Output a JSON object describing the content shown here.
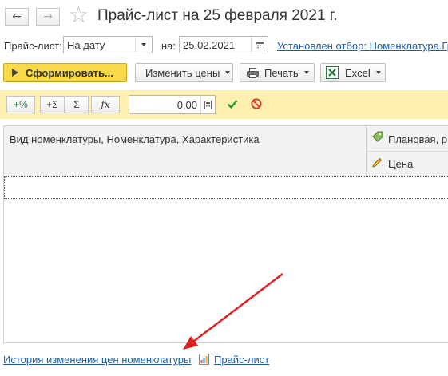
{
  "header": {
    "back_glyph": "←",
    "forward_glyph": "→",
    "star_glyph": "☆",
    "title": "Прайс-лист на 25 февраля 2021 г."
  },
  "filters": {
    "pricelist_label": "Прайс-лист:",
    "pricelist_value": "На дату",
    "date_label": "на:",
    "date_value": "25.02.2021",
    "filter_link": "Установлен отбор: Номенклатура.Гр"
  },
  "toolbar": {
    "generate_label": "Сформировать...",
    "change_prices_label": "Изменить цены",
    "print_label": "Печать",
    "excel_label": "Excel"
  },
  "calc_bar": {
    "buttons": [
      "+%",
      "+Σ",
      "Σ",
      "ƒx"
    ],
    "value": "0,00"
  },
  "table": {
    "col1_header": "Вид номенклатуры, Номенклатура, Характеристика",
    "col2_header_top": "Плановая, р",
    "col2_header_bottom": "Цена"
  },
  "footer": {
    "history_link": "История изменения цен номенклатуры",
    "pricelist_link": "Прайс-лист"
  },
  "colors": {
    "accent_yellow": "#f7d94a",
    "calc_bar_bg": "#fdf0b0",
    "link": "#1e5fa8",
    "arrow": "#e02020"
  }
}
